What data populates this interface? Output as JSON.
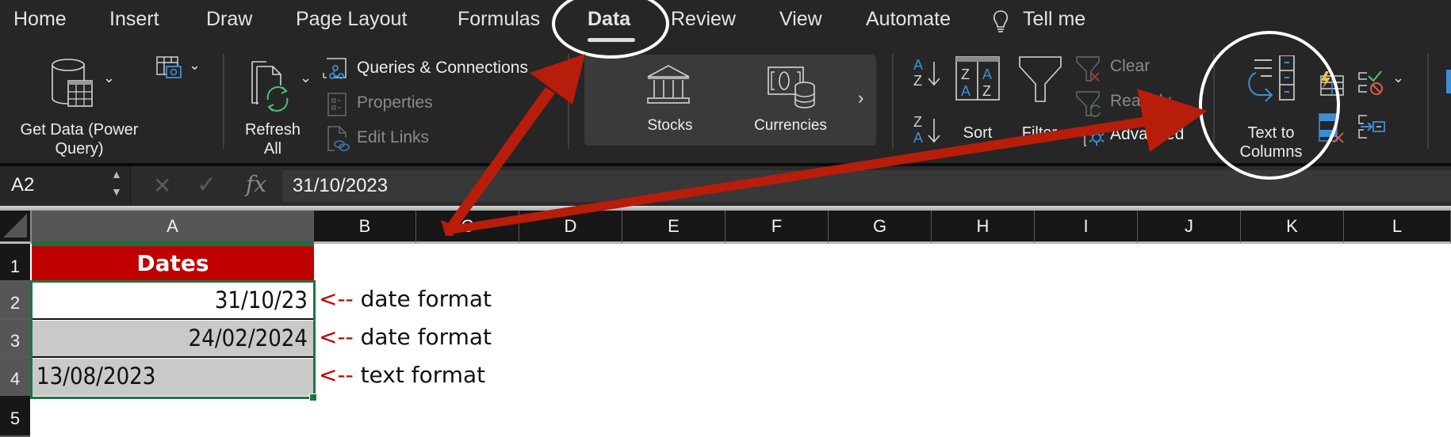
{
  "tabs": [
    {
      "label": "Home",
      "active": false
    },
    {
      "label": "Insert",
      "active": false
    },
    {
      "label": "Draw",
      "active": false
    },
    {
      "label": "Page Layout",
      "active": false
    },
    {
      "label": "Formulas",
      "active": false
    },
    {
      "label": "Data",
      "active": true
    },
    {
      "label": "Review",
      "active": false
    },
    {
      "label": "View",
      "active": false
    },
    {
      "label": "Automate",
      "active": false
    }
  ],
  "tell_me": "Tell me",
  "ribbon": {
    "get_data": {
      "line1": "Get Data (Power",
      "line2": "Query)"
    },
    "refresh_all": {
      "line1": "Refresh",
      "line2": "All"
    },
    "queries_connections": "Queries & Connections",
    "properties": "Properties",
    "edit_links": "Edit Links",
    "stocks": "Stocks",
    "currencies": "Currencies",
    "sort": "Sort",
    "filter": "Filter",
    "clear": "Clear",
    "reapply": "Reapply",
    "advanced": "Advanced",
    "text_to_columns": {
      "line1": "Text to",
      "line2": "Columns"
    }
  },
  "formula_bar": {
    "name_box": "A2",
    "formula": "31/10/2023"
  },
  "columns": [
    "A",
    "B",
    "C",
    "D",
    "E",
    "F",
    "G",
    "H",
    "I",
    "J",
    "K",
    "L"
  ],
  "selected_column": "A",
  "rows": [
    "1",
    "2",
    "3",
    "4",
    "5"
  ],
  "cells": {
    "A1": "Dates",
    "A2": "31/10/23",
    "A3": "24/02/2024",
    "A4": "13/08/2023"
  },
  "notes": [
    {
      "arrow": "<--",
      "text": "date format"
    },
    {
      "arrow": "<--",
      "text": "date format"
    },
    {
      "arrow": "<--",
      "text": "text format"
    }
  ],
  "colors": {
    "header_fill": "#c00000",
    "selection_border": "#217346",
    "annotation_arrow": "#b81c0a",
    "annotation_circle": "#ffffff",
    "note_arrow_text": "#c00000"
  }
}
